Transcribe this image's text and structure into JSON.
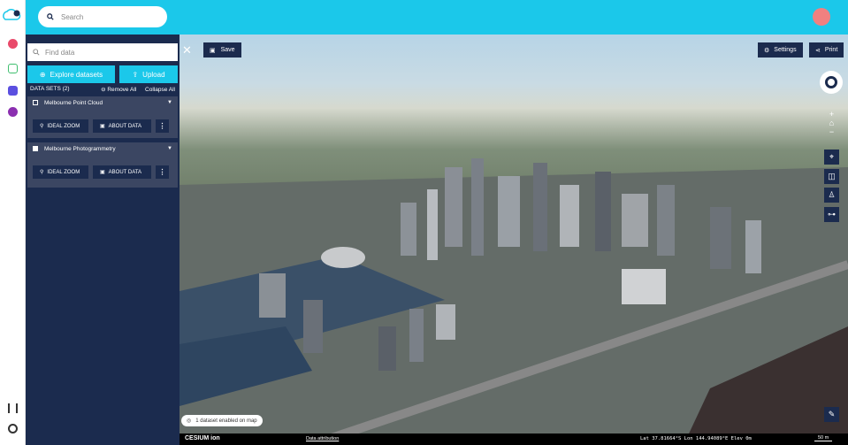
{
  "search": {
    "placeholder": "Search"
  },
  "panel": {
    "find_placeholder": "Find data",
    "explore_label": "Explore datasets",
    "upload_label": "Upload",
    "datasets_heading": "DATA SETS (2)",
    "remove_all": "Remove All",
    "collapse_all": "Collapse All",
    "datasets": [
      {
        "name": "Melbourne Point Cloud",
        "zoom": "IDEAL ZOOM",
        "about": "ABOUT DATA"
      },
      {
        "name": "Melbourne Photogrammetry",
        "zoom": "IDEAL ZOOM",
        "about": "ABOUT DATA"
      }
    ]
  },
  "toolbar": {
    "save_label": "Save",
    "settings_label": "Settings",
    "print_label": "Print"
  },
  "map": {
    "enabled_pill": "1 dataset enabled on map"
  },
  "status": {
    "cesium_label": "CESIUM ion",
    "attribution": "Data attribution",
    "coordinates": "Lat  37.81664°S  Lon  144.94089°E  Elev  0m",
    "scale": "50 m"
  },
  "colors": {
    "accent": "#1bc8ea",
    "panel": "#1b2b4e",
    "card": "#3b4662"
  }
}
